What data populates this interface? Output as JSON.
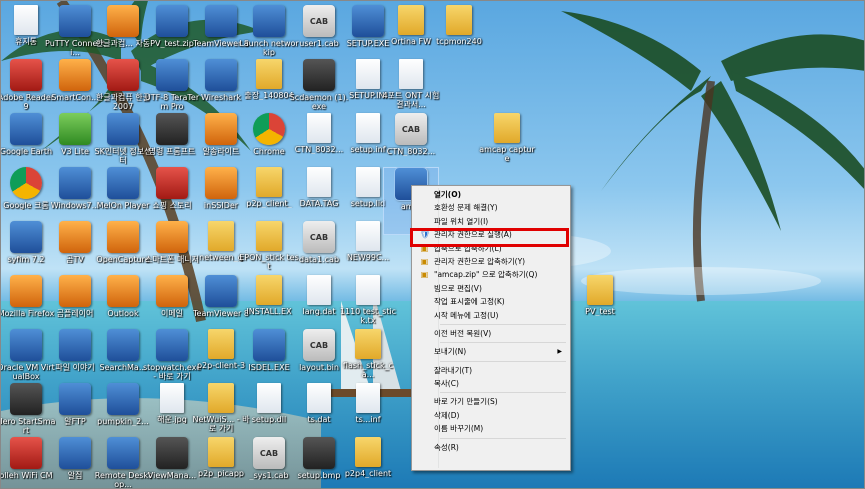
{
  "desktop_icons": [
    {
      "label": "휴지통",
      "kind": "file",
      "icon": "recycle-bin-icon"
    },
    {
      "label": "PuTTY Connecti...",
      "kind": "app",
      "icon": "putty-icon"
    },
    {
      "label": "한글과컴... 자동",
      "kind": "orange",
      "icon": "hancom-icon"
    },
    {
      "label": "PV_test.zip",
      "kind": "app",
      "icon": "zip-archive-icon"
    },
    {
      "label": "TeamViewer 8",
      "kind": "app",
      "icon": "teamviewer-icon"
    },
    {
      "label": "Launch networkip",
      "kind": "app",
      "icon": "launch-icon"
    },
    {
      "label": "user1.cab",
      "kind": "cab",
      "icon": "cab-file-icon"
    },
    {
      "label": "SETUP.EXE",
      "kind": "app",
      "icon": "setup-exe-icon"
    },
    {
      "label": "Ortina FW",
      "kind": "folder",
      "icon": "folder-icon"
    },
    {
      "label": "tcpmon240",
      "kind": "folder",
      "icon": "folder-icon"
    },
    {
      "label": "Adobe Reader 9",
      "kind": "red",
      "icon": "adobe-reader-icon"
    },
    {
      "label": "SmartCon...",
      "kind": "orange",
      "icon": "smartcon-icon"
    },
    {
      "label": "한글과컴퓨 한글 2007",
      "kind": "red",
      "icon": "hangul-icon"
    },
    {
      "label": "UTF-8 TeraTerm Pro",
      "kind": "app",
      "icon": "teraterm-icon"
    },
    {
      "label": "Wireshark",
      "kind": "app",
      "icon": "wireshark-icon"
    },
    {
      "label": "출장_140804",
      "kind": "folder",
      "icon": "folder-icon"
    },
    {
      "label": "Scdaemon (1).exe",
      "kind": "dark",
      "icon": "scdaemon-icon"
    },
    {
      "label": "SETUP.INI",
      "kind": "file",
      "icon": "ini-file-icon"
    },
    {
      "label": "4포트 ONT 시험결과서...",
      "kind": "file",
      "icon": "document-icon"
    },
    {
      "label": "Google Earth",
      "kind": "app",
      "icon": "google-earth-icon"
    },
    {
      "label": "V3 Lite",
      "kind": "green",
      "icon": "v3-lite-icon"
    },
    {
      "label": "SK인터넷 정보센터",
      "kind": "app",
      "icon": "sk-icon"
    },
    {
      "label": "명령 프롬프트",
      "kind": "dark",
      "icon": "command-prompt-icon"
    },
    {
      "label": "알송라이트",
      "kind": "orange",
      "icon": "alsong-icon"
    },
    {
      "label": "Chrome",
      "kind": "chrome",
      "icon": "chrome-icon"
    },
    {
      "label": "CTN_8032...",
      "kind": "file",
      "icon": "file-icon"
    },
    {
      "label": "setup.inf",
      "kind": "file",
      "icon": "inf-file-icon"
    },
    {
      "label": "CTN_8032...",
      "kind": "cab",
      "icon": "bin-file-icon"
    },
    {
      "label": "amcap capture",
      "kind": "folder",
      "icon": "folder-icon"
    },
    {
      "label": "Google 크롬",
      "kind": "chrome",
      "icon": "chrome-icon"
    },
    {
      "label": "Windows7...",
      "kind": "app",
      "icon": "windows7-icon"
    },
    {
      "label": "MelOn Player",
      "kind": "app",
      "icon": "melon-icon"
    },
    {
      "label": "쇼핑 스토리",
      "kind": "red",
      "icon": "shopping-icon"
    },
    {
      "label": "inSSIDer",
      "kind": "orange",
      "icon": "inssider-icon"
    },
    {
      "label": "p2p_client_",
      "kind": "folder",
      "icon": "folder-icon"
    },
    {
      "label": "DATA.TAG",
      "kind": "file",
      "icon": "file-icon"
    },
    {
      "label": "setup.lid",
      "kind": "file",
      "icon": "file-icon"
    },
    {
      "label": "am...",
      "kind": "app",
      "icon": "amcap-icon"
    },
    {
      "label": "syfim 7.2",
      "kind": "app",
      "icon": "syfim-icon"
    },
    {
      "label": "곰TV",
      "kind": "orange",
      "icon": "gomtv-icon"
    },
    {
      "label": "OpenCapture",
      "kind": "orange",
      "icon": "opencapture-icon"
    },
    {
      "label": "스마트폰 매니저",
      "kind": "orange",
      "icon": "smartphone-manager-icon"
    },
    {
      "label": "netween_g",
      "kind": "folder",
      "icon": "folder-icon"
    },
    {
      "label": "EPON_stick test",
      "kind": "folder",
      "icon": "folder-icon"
    },
    {
      "label": "data1.cab",
      "kind": "cab",
      "icon": "cab-file-icon"
    },
    {
      "label": "NEW99C...",
      "kind": "file",
      "icon": "file-icon"
    },
    {
      "label": "Mozilla Firefox",
      "kind": "orange",
      "icon": "firefox-icon"
    },
    {
      "label": "곰플레이어",
      "kind": "orange",
      "icon": "gomplayer-icon"
    },
    {
      "label": "Outlook",
      "kind": "orange",
      "icon": "outlook-icon"
    },
    {
      "label": "이메일",
      "kind": "orange",
      "icon": "email-icon"
    },
    {
      "label": "TeamViewer 8",
      "kind": "app",
      "icon": "teamviewer-icon"
    },
    {
      "label": "INSTALL.EX",
      "kind": "folder",
      "icon": "folder-icon"
    },
    {
      "label": "lang.dat",
      "kind": "file",
      "icon": "dat-file-icon"
    },
    {
      "label": "1110 test_stick.tx",
      "kind": "file",
      "icon": "text-file-icon"
    },
    {
      "label": "Oracle VM VirtualBox",
      "kind": "app",
      "icon": "virtualbox-icon"
    },
    {
      "label": "파일 이야기",
      "kind": "app",
      "icon": "file-story-icon"
    },
    {
      "label": "SearchMa...",
      "kind": "app",
      "icon": "searchmaster-icon"
    },
    {
      "label": "stopwatch.exe - 바로 가기",
      "kind": "app",
      "icon": "stopwatch-icon"
    },
    {
      "label": "p2p-client-3",
      "kind": "folder",
      "icon": "folder-icon"
    },
    {
      "label": "ISDEL.EXE",
      "kind": "app",
      "icon": "isdel-icon"
    },
    {
      "label": "layout.bin",
      "kind": "cab",
      "icon": "bin-file-icon"
    },
    {
      "label": "flash_stick_ca...",
      "kind": "folder",
      "icon": "folder-icon"
    },
    {
      "label": "Nero StartSmart",
      "kind": "dark",
      "icon": "nero-icon"
    },
    {
      "label": "알FTP",
      "kind": "app",
      "icon": "alftp-icon"
    },
    {
      "label": "pumpkin_2...",
      "kind": "app",
      "icon": "pumpkin-icon"
    },
    {
      "label": "해운.jpg",
      "kind": "file",
      "icon": "image-file-icon"
    },
    {
      "label": "NetWuiS... - 바로 가기",
      "kind": "folder",
      "icon": "folder-icon"
    },
    {
      "label": "setup.dll",
      "kind": "file",
      "icon": "dll-file-icon"
    },
    {
      "label": "ts.dat",
      "kind": "file",
      "icon": "dat-file-icon"
    },
    {
      "label": "ts...inf",
      "kind": "file",
      "icon": "file-icon"
    },
    {
      "label": "olleh WiFi CM",
      "kind": "red",
      "icon": "olleh-wifi-icon"
    },
    {
      "label": "알집",
      "kind": "app",
      "icon": "alzip-icon"
    },
    {
      "label": "Remote Desktop...",
      "kind": "app",
      "icon": "remote-desktop-icon"
    },
    {
      "label": "ViewMana...",
      "kind": "dark",
      "icon": "viewmanager-icon"
    },
    {
      "label": "p2p_picapp",
      "kind": "folder",
      "icon": "folder-icon"
    },
    {
      "label": "_sys1.cab",
      "kind": "cab",
      "icon": "cab-file-icon"
    },
    {
      "label": "setup.bmp",
      "kind": "dark",
      "icon": "bmp-file-icon"
    },
    {
      "label": "p2p4_client",
      "kind": "folder",
      "icon": "folder-icon"
    },
    {
      "label": "PV_test",
      "kind": "folder",
      "icon": "folder-icon"
    }
  ],
  "context_menu": {
    "items": [
      {
        "label": "열기(O)",
        "icon": "",
        "bold": true,
        "type": "item"
      },
      {
        "label": "호환성 문제 해결(Y)",
        "icon": "",
        "type": "item"
      },
      {
        "label": "파일 위치 열기(I)",
        "icon": "",
        "type": "item"
      },
      {
        "label": "관리자 권한으로 실행(A)",
        "icon": "shield-icon",
        "type": "item"
      },
      {
        "label": "압축으로 압축하기(L)",
        "icon": "alzip-icon",
        "type": "item"
      },
      {
        "label": "관리자 권한으로 압축하기(Y)",
        "icon": "alzip-icon",
        "type": "item"
      },
      {
        "label": "\"amcap.zip\" 으로 압축하기(Q)",
        "icon": "alzip-icon",
        "type": "item"
      },
      {
        "label": "빔으로 편집(V)",
        "icon": "",
        "type": "item"
      },
      {
        "label": "작업 표시줄에 고정(K)",
        "icon": "",
        "type": "item"
      },
      {
        "label": "시작 메뉴에 고정(U)",
        "icon": "",
        "type": "item"
      },
      {
        "type": "separator"
      },
      {
        "label": "이전 버전 복원(V)",
        "icon": "",
        "type": "item"
      },
      {
        "type": "separator"
      },
      {
        "label": "보내기(N)",
        "icon": "",
        "type": "item",
        "submenu": true
      },
      {
        "type": "separator"
      },
      {
        "label": "잘라내기(T)",
        "icon": "",
        "type": "item"
      },
      {
        "label": "복사(C)",
        "icon": "",
        "type": "item"
      },
      {
        "type": "separator"
      },
      {
        "label": "바로 가기 만들기(S)",
        "icon": "",
        "type": "item"
      },
      {
        "label": "삭제(D)",
        "icon": "",
        "type": "item"
      },
      {
        "label": "이름 바꾸기(M)",
        "icon": "",
        "type": "item"
      },
      {
        "type": "separator"
      },
      {
        "label": "속성(R)",
        "icon": "",
        "type": "item"
      }
    ],
    "highlighted": "관리자 권한으로 실행(A)"
  },
  "colors": {
    "highlight_border": "#e00000",
    "menu_background": "#f0f0f0",
    "sky": "#5aa7e0",
    "sea": "#1d6fb0"
  }
}
